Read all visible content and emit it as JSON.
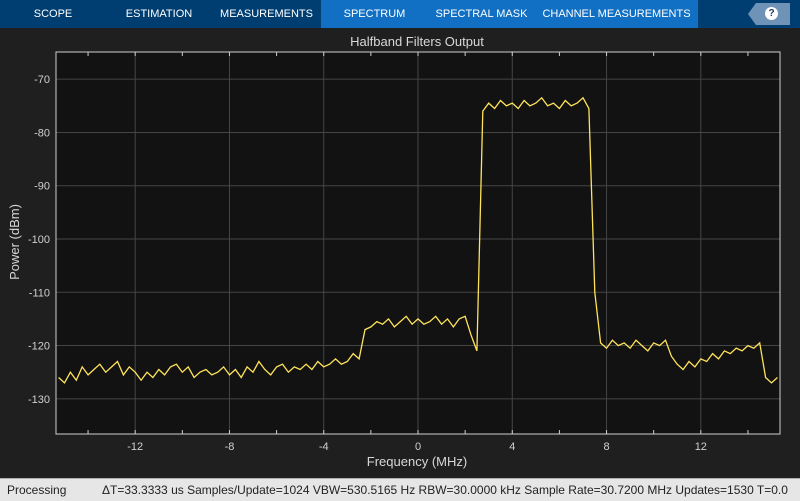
{
  "toolbar": {
    "tabs": [
      {
        "label": "SCOPE",
        "active": false
      },
      {
        "label": "ESTIMATION",
        "active": false
      },
      {
        "label": "MEASUREMENTS",
        "active": false
      },
      {
        "label": "SPECTRUM",
        "active": true
      },
      {
        "label": "SPECTRAL MASK",
        "active": true
      },
      {
        "label": "CHANNEL MEASUREMENTS",
        "active": true
      }
    ],
    "help_label": "?"
  },
  "status": {
    "state": "Processing",
    "info": "ΔT=33.3333 us  Samples/Update=1024  VBW=530.5165 Hz  RBW=30.0000 kHz  Sample Rate=30.7200 MHz  Updates=1530  T=0.0"
  },
  "colors": {
    "trace": "#ffe35a",
    "plot_bg": "#121212",
    "grid": "#454545",
    "toolbar": "#003e72",
    "tab_active": "#1170c4"
  },
  "chart_data": {
    "type": "line",
    "title": "Halfband Filters Output",
    "xlabel": "Frequency (MHz)",
    "ylabel": "Power (dBm)",
    "xlim": [
      -15.36,
      15.36
    ],
    "ylim": [
      -136.6,
      -64.9
    ],
    "xticks": [
      -12,
      -8,
      -4,
      0,
      4,
      8,
      12
    ],
    "yticks": [
      -70,
      -80,
      -90,
      -100,
      -110,
      -120,
      -130
    ],
    "grid": true,
    "series": [
      {
        "x": [
          -15.25,
          -15,
          -14.75,
          -14.5,
          -14.25,
          -14,
          -13.75,
          -13.5,
          -13.25,
          -13,
          -12.75,
          -12.5,
          -12.25,
          -12,
          -11.75,
          -11.5,
          -11.25,
          -11,
          -10.75,
          -10.5,
          -10.25,
          -10,
          -9.75,
          -9.5,
          -9.25,
          -9,
          -8.75,
          -8.5,
          -8.25,
          -8,
          -7.75,
          -7.5,
          -7.25,
          -7,
          -6.75,
          -6.5,
          -6.25,
          -6,
          -5.75,
          -5.5,
          -5.25,
          -5,
          -4.75,
          -4.5,
          -4.25,
          -4,
          -3.75,
          -3.5,
          -3.25,
          -3,
          -2.75,
          -2.5,
          -2.25,
          -2,
          -1.75,
          -1.5,
          -1.25,
          -1,
          -0.75,
          -0.5,
          -0.25,
          0,
          0.25,
          0.5,
          0.75,
          1,
          1.25,
          1.5,
          1.75,
          2,
          2.25,
          2.5,
          2.75,
          3,
          3.25,
          3.5,
          3.75,
          4,
          4.25,
          4.5,
          4.75,
          5,
          5.25,
          5.5,
          5.75,
          6,
          6.25,
          6.5,
          6.75,
          7,
          7.25,
          7.5,
          7.75,
          8,
          8.25,
          8.5,
          8.75,
          9,
          9.25,
          9.5,
          9.75,
          10,
          10.25,
          10.5,
          10.75,
          11,
          11.25,
          11.5,
          11.75,
          12,
          12.25,
          12.5,
          12.75,
          13,
          13.25,
          13.5,
          13.75,
          14,
          14.25,
          14.5,
          14.75,
          15,
          15.25
        ],
        "y": [
          -126,
          -127,
          -125,
          -126.5,
          -124,
          -125.5,
          -124.5,
          -123.5,
          -125,
          -124,
          -123,
          -125.5,
          -124,
          -125,
          -126.5,
          -125,
          -126,
          -124.5,
          -125.5,
          -124,
          -123.5,
          -125,
          -124,
          -126,
          -125,
          -124.5,
          -125.5,
          -125,
          -124,
          -125.5,
          -124.5,
          -126,
          -124,
          -125,
          -123,
          -124.5,
          -125.5,
          -124,
          -123.5,
          -125,
          -124,
          -124.5,
          -123.5,
          -124.5,
          -123,
          -124,
          -123.5,
          -122.5,
          -123.5,
          -123,
          -121.5,
          -122.5,
          -117,
          -116.5,
          -115.5,
          -116,
          -115,
          -116.5,
          -115.5,
          -114.5,
          -116,
          -115,
          -116,
          -115.5,
          -114.5,
          -116,
          -115,
          -116.5,
          -115,
          -114.5,
          -118,
          -121,
          -76,
          -74.5,
          -75.5,
          -74,
          -75,
          -74.5,
          -75.5,
          -74,
          -75,
          -74.5,
          -73.5,
          -75,
          -74.5,
          -75.5,
          -74,
          -75,
          -74.5,
          -73.5,
          -75.5,
          -110,
          -119.5,
          -120.5,
          -119,
          -120,
          -119.5,
          -120.5,
          -119,
          -120,
          -121,
          -119.5,
          -120,
          -119,
          -122,
          -123.5,
          -124.5,
          -123,
          -124,
          -122.5,
          -123,
          -121.5,
          -122.5,
          -121,
          -121.5,
          -120.5,
          -121,
          -120,
          -120.5,
          -119.5,
          -126,
          -127,
          -126
        ]
      }
    ]
  }
}
